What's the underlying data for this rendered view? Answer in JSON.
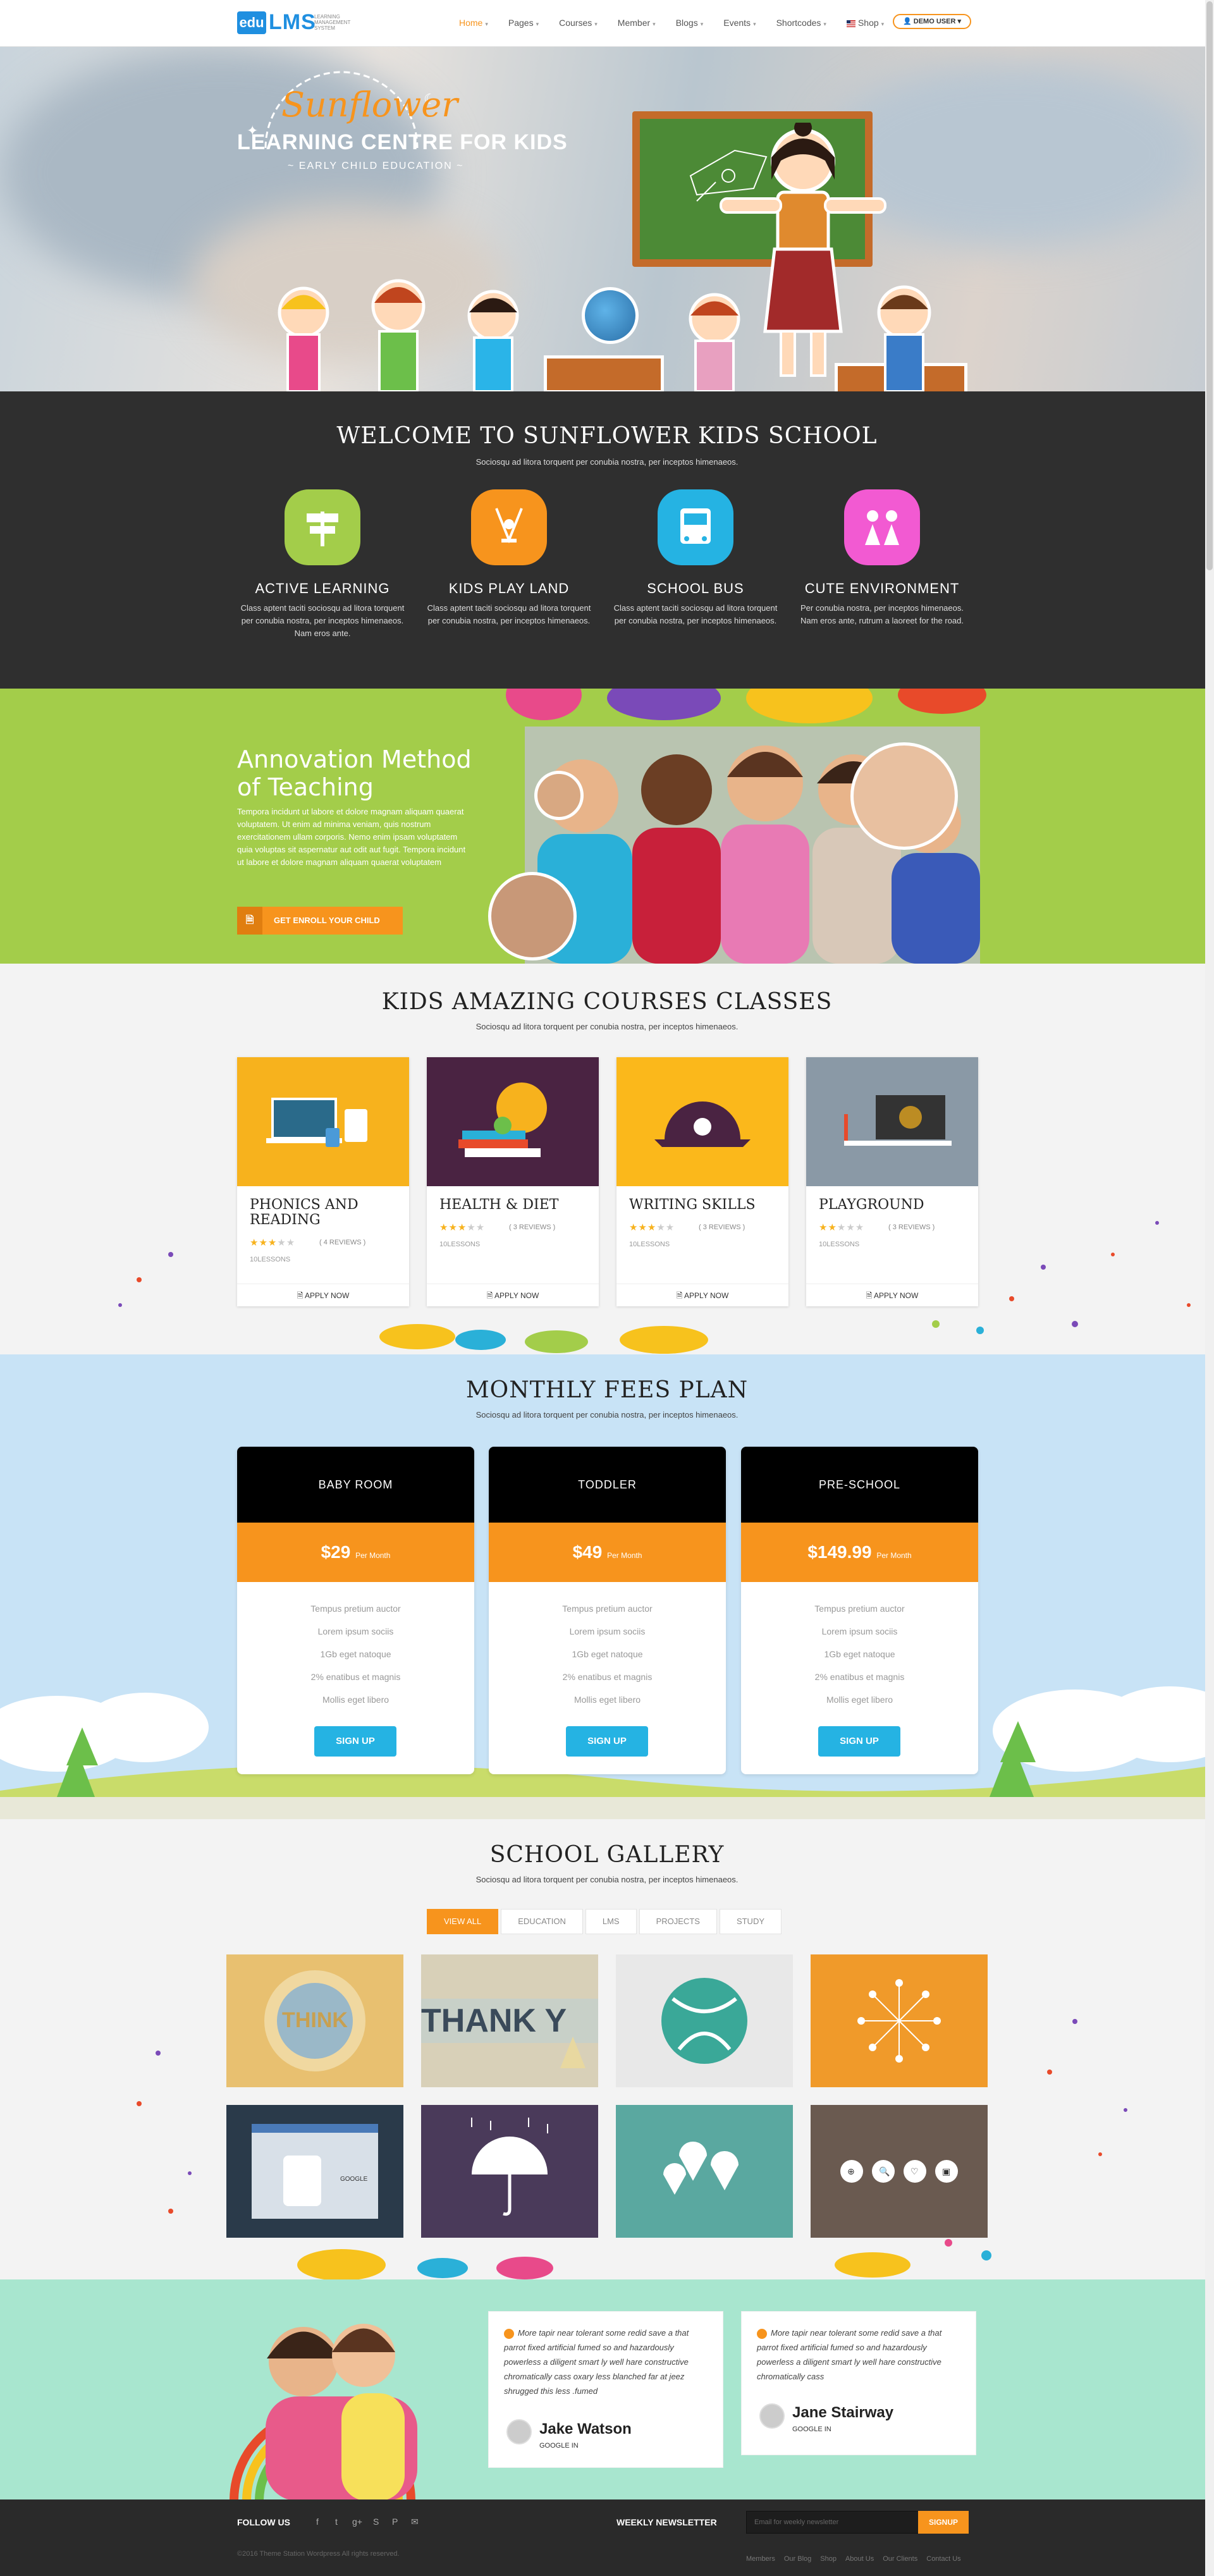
{
  "header": {
    "logo": {
      "edu": "edu",
      "lms": "LMS",
      "sub": "LEARNING MANAGEMENT SYSTEM"
    },
    "nav": [
      {
        "label": "Home",
        "active": true
      },
      {
        "label": "Pages"
      },
      {
        "label": "Courses"
      },
      {
        "label": "Member"
      },
      {
        "label": "Blogs"
      },
      {
        "label": "Events"
      },
      {
        "label": "Shortcodes"
      },
      {
        "label": "Shop"
      }
    ],
    "demo_user": "DEMO USER"
  },
  "hero": {
    "title": "Sunflower",
    "subtitle": "LEARNING CENTRE FOR KIDS",
    "tagline": "~ EARLY CHILD EDUCATION ~"
  },
  "welcome": {
    "title": "WELCOME TO SUNFLOWER KIDS SCHOOL",
    "subtitle": "Sociosqu ad litora torquent per conubia nostra, per inceptos himenaeos.",
    "features": [
      {
        "title": "ACTIVE LEARNING",
        "text": "Class aptent taciti sociosqu ad litora torquent per conubia nostra, per inceptos himenaeos. Nam eros ante.",
        "color": "#a3cd4a",
        "icon": "signpost-icon"
      },
      {
        "title": "KIDS PLAY LAND",
        "text": "Class aptent taciti sociosqu ad litora torquent per conubia nostra, per inceptos himenaeos.",
        "color": "#f7941d",
        "icon": "swing-icon"
      },
      {
        "title": "SCHOOL BUS",
        "text": "Class aptent taciti sociosqu ad litora torquent per conubia nostra, per inceptos himenaeos.",
        "color": "#25b3e3",
        "icon": "bus-icon"
      },
      {
        "title": "CUTE ENVIRONMENT",
        "text": "Per conubia nostra, per inceptos himenaeos. Nam eros ante, rutrum a laoreet for the road.",
        "color": "#f25ad2",
        "icon": "kids-icon"
      }
    ]
  },
  "innovation": {
    "title": "Annovation Method of Teaching",
    "text": "Tempora incidunt ut labore et dolore magnam aliquam quaerat voluptatem. Ut enim ad minima veniam, quis nostrum exercitationem ullam corporis. Nemo enim ipsam voluptatem quia voluptas sit aspernatur aut odit aut fugit. Tempora incidunt ut labore et dolore magnam aliquam quaerat voluptatem",
    "button": "GET ENROLL YOUR CHILD"
  },
  "courses": {
    "title": "KIDS AMAZING COURSES CLASSES",
    "subtitle": "Sociosqu ad litora torquent per conubia nostra, per inceptos himenaeos.",
    "items": [
      {
        "title": "PHONICS AND READING",
        "rating": 3,
        "reviews": "( 4 REVIEWS )",
        "lessons": "10LESSONS",
        "apply": "APPLY NOW",
        "bg": "#f7b21d"
      },
      {
        "title": "HEALTH & DIET",
        "rating": 3,
        "reviews": "( 3 REVIEWS )",
        "lessons": "10LESSONS",
        "apply": "APPLY NOW",
        "bg": "#4a2342"
      },
      {
        "title": "WRITING SKILLS",
        "rating": 3,
        "reviews": "( 3 REVIEWS )",
        "lessons": "10LESSONS",
        "apply": "APPLY NOW",
        "bg": "#fbb81b"
      },
      {
        "title": "PLAYGROUND",
        "rating": 2,
        "reviews": "( 3 REVIEWS )",
        "lessons": "10LESSONS",
        "apply": "APPLY NOW",
        "bg": "#8a99a6"
      }
    ]
  },
  "pricing": {
    "title": "MONTHLY FEES PLAN",
    "subtitle": "Sociosqu ad litora torquent per conubia nostra, per inceptos himenaeos.",
    "plans": [
      {
        "name": "BABY ROOM",
        "price": "$29",
        "per": "Per Month",
        "features": [
          "Tempus pretium auctor",
          "Lorem ipsum sociis",
          "1Gb eget natoque",
          "2% enatibus et magnis",
          "Mollis eget libero"
        ],
        "button": "SIGN UP"
      },
      {
        "name": "TODDLER",
        "price": "$49",
        "per": "Per Month",
        "features": [
          "Tempus pretium auctor",
          "Lorem ipsum sociis",
          "1Gb eget natoque",
          "2% enatibus et magnis",
          "Mollis eget libero"
        ],
        "button": "SIGN UP"
      },
      {
        "name": "PRE-SCHOOL",
        "price": "$149.99",
        "per": "Per Month",
        "features": [
          "Tempus pretium auctor",
          "Lorem ipsum sociis",
          "1Gb eget natoque",
          "2% enatibus et magnis",
          "Mollis eget libero"
        ],
        "button": "SIGN UP"
      }
    ]
  },
  "gallery": {
    "title": "SCHOOL GALLERY",
    "subtitle": "Sociosqu ad litora torquent per conubia nostra, per inceptos himenaeos.",
    "filters": [
      "VIEW ALL",
      "EDUCATION",
      "LMS",
      "PROJECTS",
      "STUDY"
    ],
    "texts": {
      "think": "THINK",
      "thank": "THANK Y",
      "google": "GOOGLE"
    }
  },
  "testimonials": [
    {
      "text": "More tapir near tolerant some redid save a that parrot fixed artificial fumed so and hazardously powerless a diligent smart ly well hare constructive chromatically cass oxary less blanched far at jeez shrugged this less .fumed",
      "name": "Jake Watson",
      "role": "GOOGLE IN"
    },
    {
      "text": "More tapir near tolerant some redid save a that parrot fixed artificial fumed so and hazardously powerless a diligent smart ly well hare constructive chromatically cass",
      "name": "Jane Stairway",
      "role": "GOOGLE IN"
    }
  ],
  "footer": {
    "follow": "FOLLOW US",
    "social": [
      "facebook-icon",
      "twitter-icon",
      "googleplus-icon",
      "skype-icon",
      "pinterest-icon",
      "mail-icon"
    ],
    "newsletter": "WEEKLY NEWSLETTER",
    "email_placeholder": "Email for weekly newsletter",
    "signup": "SIGNUP",
    "copyright": "©2016 Theme Station Wordpress All rights reserved.",
    "links": [
      "Members",
      "Our Blog",
      "Shop",
      "About Us",
      "Our Clients",
      "Contact Us"
    ]
  }
}
